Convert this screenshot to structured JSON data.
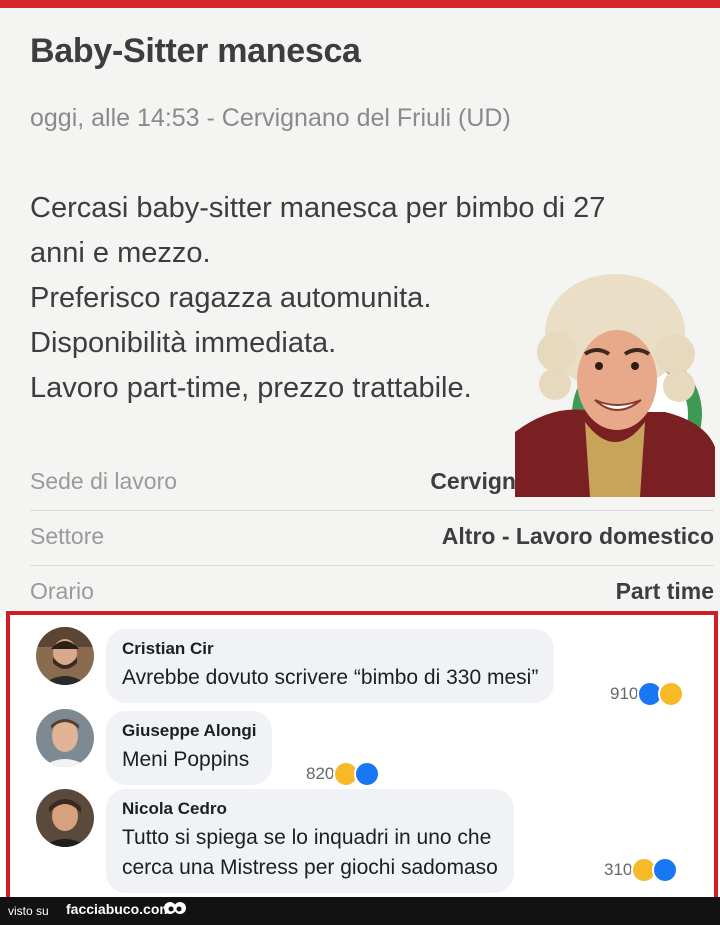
{
  "ad": {
    "title": "Baby-Sitter manesca",
    "meta": "oggi, alle 14:53 - Cervignano del Friuli (UD)",
    "description_lines": [
      "Cercasi baby-sitter manesca per bimbo di 27",
      "anni e mezzo.",
      "Preferisco ragazza automunita.",
      "Disponibilità immediata.",
      "Lavoro part-time, prezzo trattabile."
    ],
    "details": [
      {
        "label": "Sede di lavoro",
        "value": "Cervignano del Friuli (UD)"
      },
      {
        "label": "Settore",
        "value": "Altro - Lavoro domestico"
      },
      {
        "label": "Orario",
        "value": "Part time"
      }
    ],
    "accent_color": "#d8262e"
  },
  "comments": [
    {
      "name": "Cristian Cir",
      "lines": [
        "Avrebbe dovuto scrivere “bimbo di 330 mesi”"
      ],
      "count": "910",
      "reactions": [
        "like-icon",
        "haha-icon"
      ]
    },
    {
      "name": "Giuseppe Alongi",
      "lines": [
        "Meni Poppins"
      ],
      "count": "820",
      "reactions": [
        "haha-icon",
        "like-icon"
      ]
    },
    {
      "name": "Nicola Cedro",
      "lines": [
        "Tutto si spiega se lo inquadri in uno che",
        "cerca una Mistress per giochi sadomaso"
      ],
      "count": "310",
      "reactions": [
        "haha-icon",
        "like-icon"
      ]
    }
  ],
  "comments_border_color": "#d31c24",
  "footer": {
    "visto_su": "visto su",
    "brand": "facciabuco.com"
  }
}
